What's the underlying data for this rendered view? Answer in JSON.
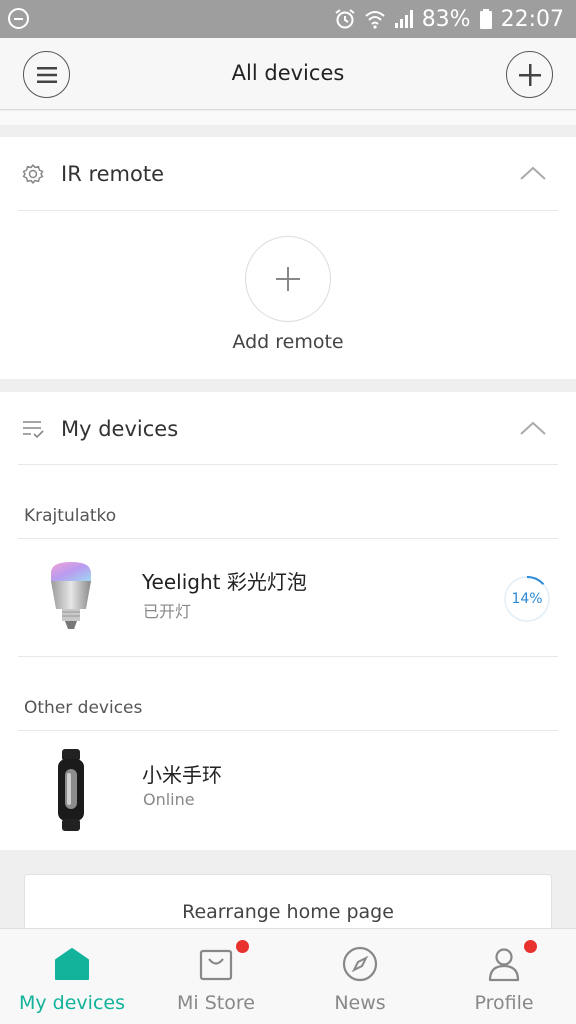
{
  "status_bar": {
    "battery_percent": "83%",
    "time": "22:07"
  },
  "header": {
    "title": "All devices"
  },
  "ir_section": {
    "title": "IR remote",
    "add_label": "Add remote"
  },
  "devices_section": {
    "title": "My devices",
    "groups": [
      {
        "name": "Krajtulatko",
        "devices": [
          {
            "name": "Yeelight 彩光灯泡",
            "status": "已开灯",
            "progress": "14%"
          }
        ]
      },
      {
        "name": "Other devices",
        "devices": [
          {
            "name": "小米手环",
            "status": "Online"
          }
        ]
      }
    ]
  },
  "rearrange_label": "Rearrange home page",
  "bottom_nav": {
    "tabs": [
      {
        "label": "My devices",
        "icon": "home-icon",
        "active": true
      },
      {
        "label": "Mi Store",
        "icon": "shopping-bag-icon",
        "badge": true
      },
      {
        "label": "News",
        "icon": "compass-icon"
      },
      {
        "label": "Profile",
        "icon": "person-icon",
        "badge": true
      }
    ]
  },
  "colors": {
    "accent": "#12b39a",
    "badge": "#e8322f",
    "progress": "#2a8ad8"
  }
}
